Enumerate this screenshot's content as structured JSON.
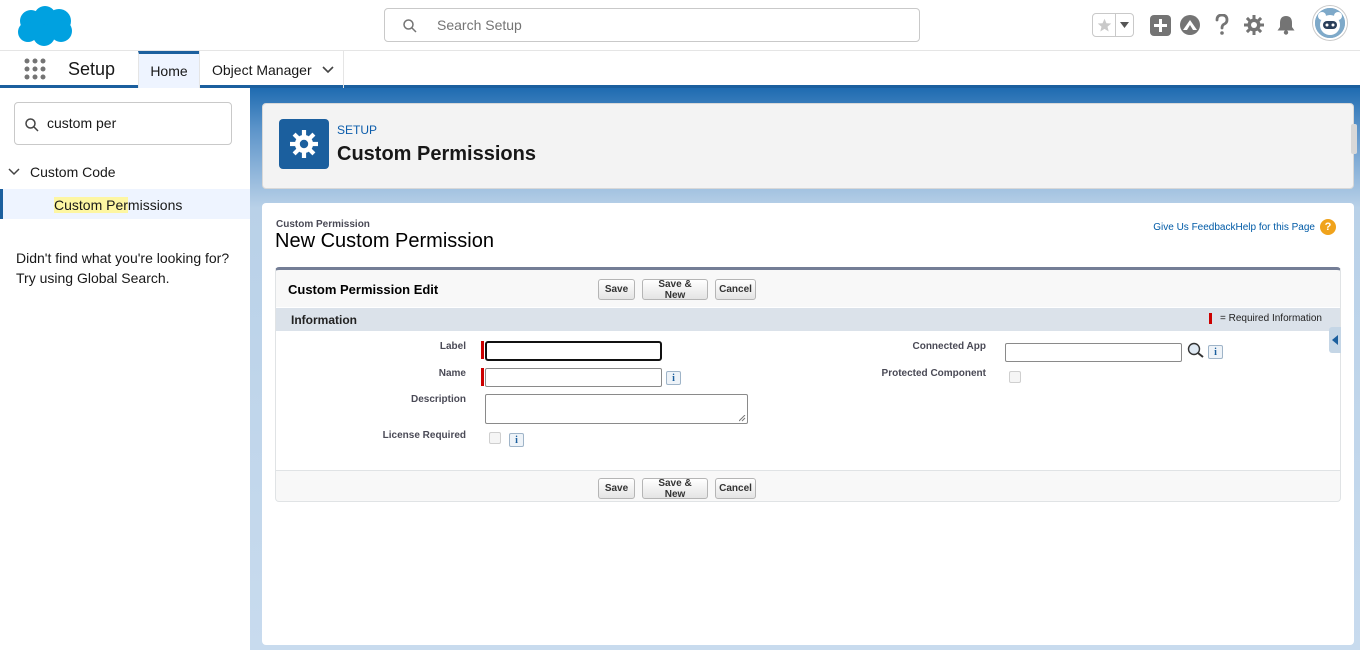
{
  "header": {
    "search_placeholder": "Search Setup",
    "icons": [
      "salesforce-logo",
      "search-icon",
      "star-icon",
      "dropdown-icon",
      "add-icon",
      "trailhead-icon",
      "help-icon",
      "gear-icon",
      "bell-icon",
      "avatar"
    ]
  },
  "nav": {
    "app_name": "Setup",
    "tabs": [
      {
        "label": "Home",
        "active": true
      },
      {
        "label": "Object Manager",
        "active": false
      }
    ]
  },
  "sidebar": {
    "quickfind_value": "custom per",
    "tree": {
      "parent_label": "Custom Code",
      "child_label_highlight": "Custom Per",
      "child_label_rest": "missions"
    },
    "not_found_line1": "Didn't find what you're looking for?",
    "not_found_line2": "Try using Global Search."
  },
  "page_header": {
    "eyebrow": "SETUP",
    "title": "Custom Permissions"
  },
  "content": {
    "breadcrumb_type": "Custom Permission",
    "breadcrumb_title": "New Custom Permission",
    "feedback_link": "Give Us Feedback",
    "help_link": "Help for this Page",
    "block_title": "Custom Permission Edit",
    "buttons": {
      "save": "Save",
      "save_new": "Save & New",
      "cancel": "Cancel"
    },
    "section_title": "Information",
    "required_legend": "= Required Information",
    "fields": {
      "label": "Label",
      "name": "Name",
      "description": "Description",
      "license_required": "License Required",
      "connected_app": "Connected App",
      "protected_component": "Protected Component"
    },
    "info_glyph": "i"
  },
  "colors": {
    "brand_blue": "#1b5f9e",
    "required_red": "#cc0000",
    "help_orange": "#f0a31c",
    "highlight_yellow": "#fdf6a3"
  }
}
